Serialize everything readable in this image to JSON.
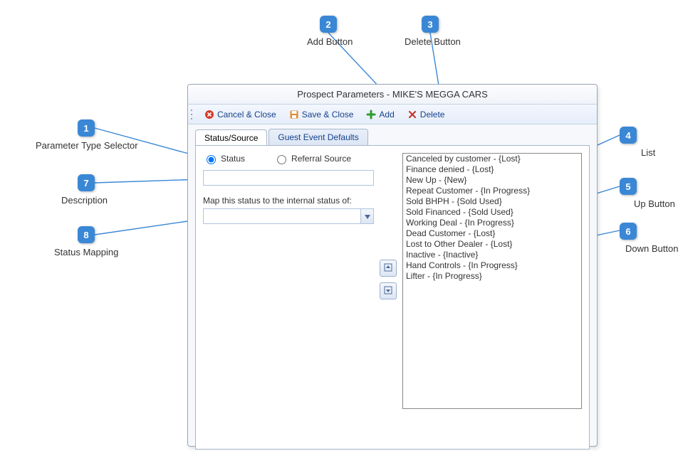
{
  "window": {
    "title": "Prospect Parameters - MIKE'S MEGGA CARS"
  },
  "toolbar": {
    "cancel_label": "Cancel & Close",
    "save_label": "Save & Close",
    "add_label": "Add",
    "delete_label": "Delete"
  },
  "tabs": {
    "status_source": "Status/Source",
    "guest_event_defaults": "Guest Event Defaults"
  },
  "radios": {
    "status": "Status",
    "referral": "Referral Source"
  },
  "form": {
    "description_value": "",
    "mapping_label": "Map this status to the internal status of:",
    "mapping_value": ""
  },
  "list": [
    "Canceled by customer - {Lost}",
    "Finance denied - {Lost}",
    "New Up - {New}",
    "Repeat Customer - {In Progress}",
    "Sold BHPH - {Sold Used}",
    "Sold Financed - {Sold Used}",
    "Working Deal - {In Progress}",
    "Dead Customer - {Lost}",
    "Lost to Other Dealer - {Lost}",
    "Inactive - {Inactive}",
    "Hand Controls - {In Progress}",
    "Lifter - {In Progress}"
  ],
  "annotations": {
    "n1": "1",
    "l1": "Parameter Type Selector",
    "n2": "2",
    "l2": "Add Button",
    "n3": "3",
    "l3": "Delete Button",
    "n4": "4",
    "l4": "List",
    "n5": "5",
    "l5": "Up Button",
    "n6": "6",
    "l6": "Down Button",
    "n7": "7",
    "l7": "Description",
    "n8": "8",
    "l8": "Status Mapping"
  }
}
